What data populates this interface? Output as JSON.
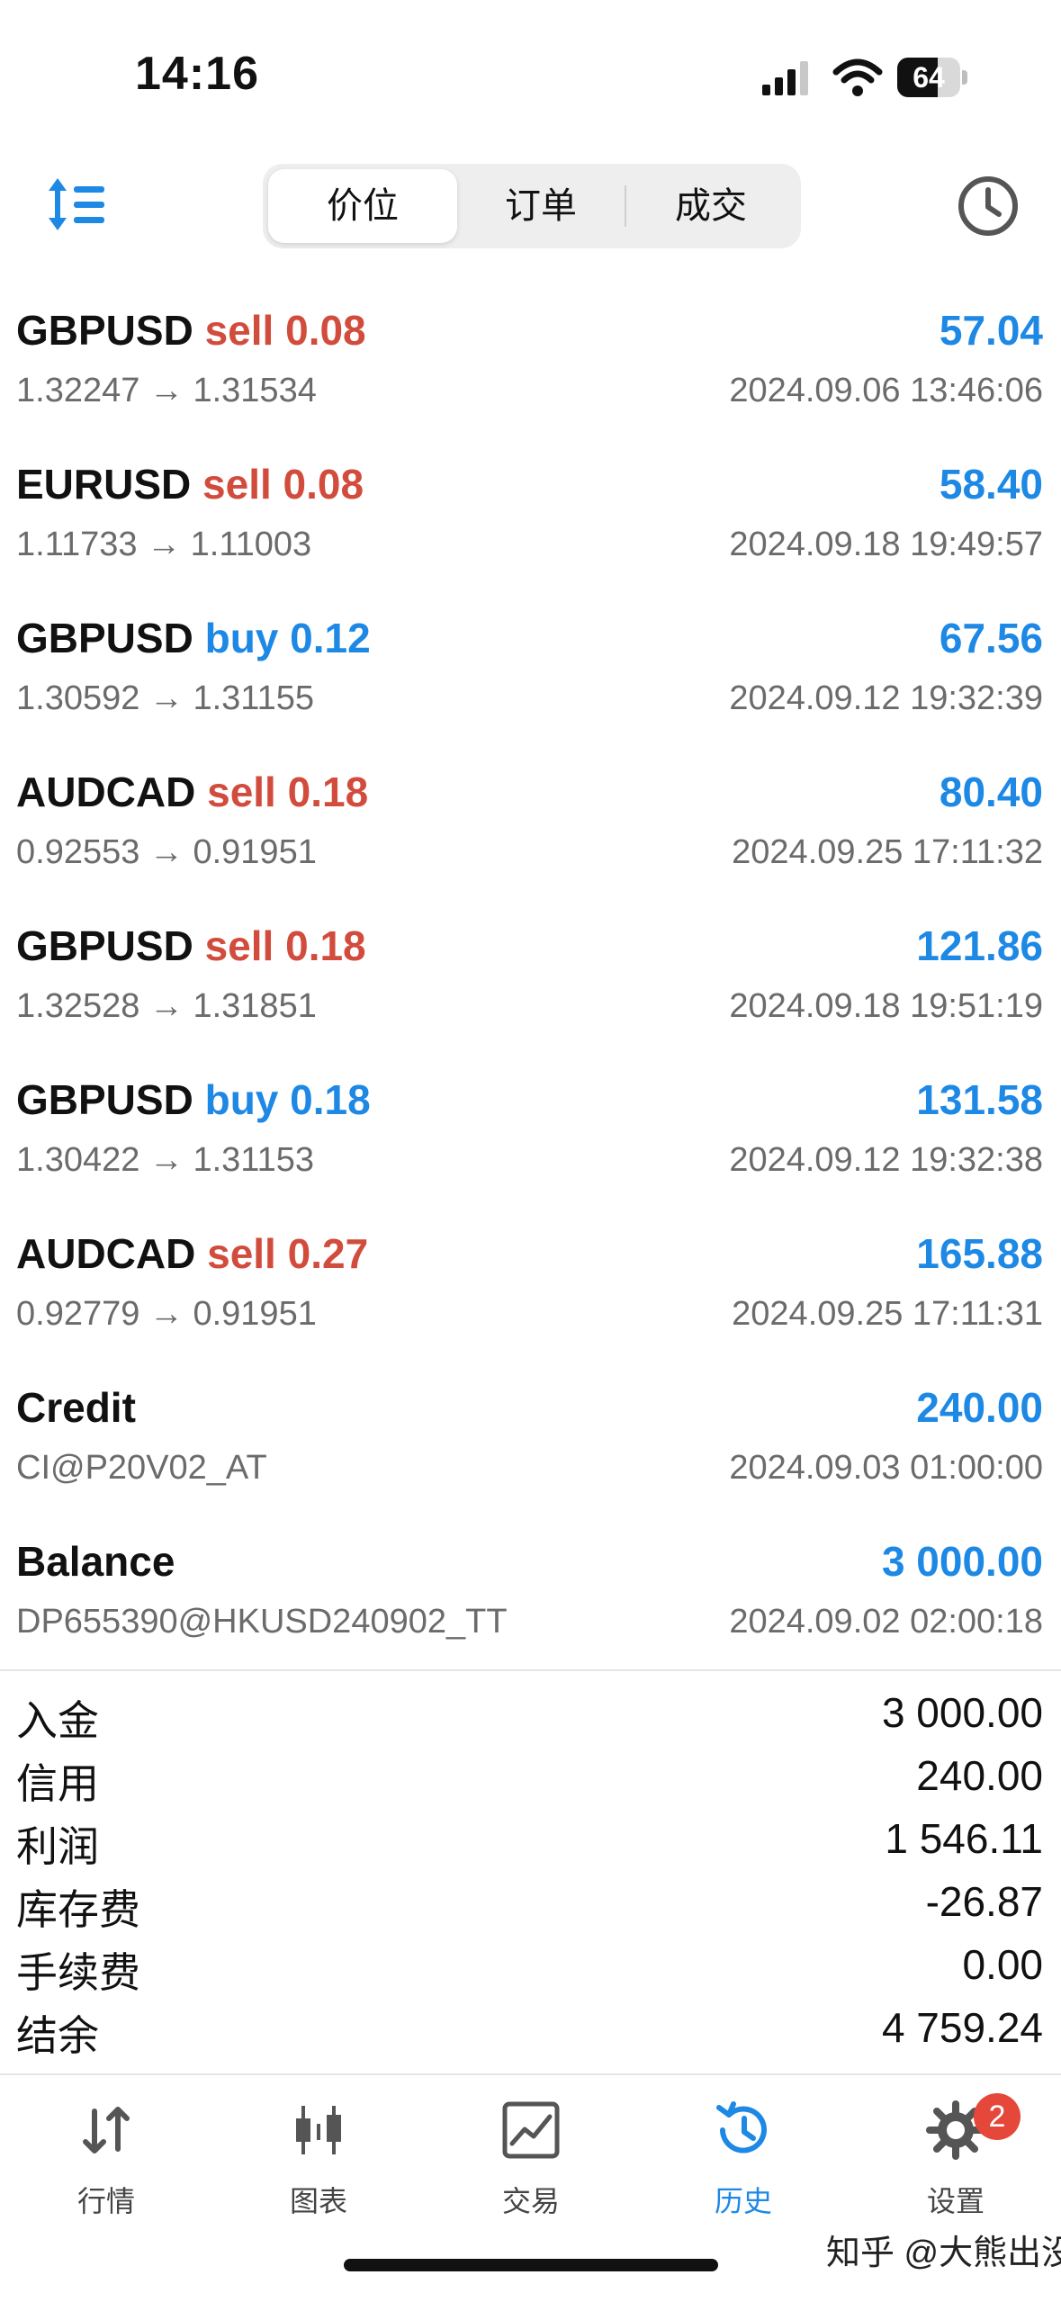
{
  "status_bar": {
    "time": "14:16",
    "battery": "64",
    "battery_level": 0.64
  },
  "segmented_tabs": [
    {
      "label": "价位",
      "active": true
    },
    {
      "label": "订单",
      "active": false
    },
    {
      "label": "成交",
      "active": false
    }
  ],
  "history": [
    {
      "symbol": "GBPUSD",
      "side": "sell",
      "volume": "0.08",
      "amount": "57.04",
      "detail": "1.32247 → 1.31534",
      "datetime": "2024.09.06 13:46:06"
    },
    {
      "symbol": "EURUSD",
      "side": "sell",
      "volume": "0.08",
      "amount": "58.40",
      "detail": "1.11733 → 1.11003",
      "datetime": "2024.09.18 19:49:57"
    },
    {
      "symbol": "GBPUSD",
      "side": "buy",
      "volume": "0.12",
      "amount": "67.56",
      "detail": "1.30592 → 1.31155",
      "datetime": "2024.09.12 19:32:39"
    },
    {
      "symbol": "AUDCAD",
      "side": "sell",
      "volume": "0.18",
      "amount": "80.40",
      "detail": "0.92553 → 0.91951",
      "datetime": "2024.09.25 17:11:32"
    },
    {
      "symbol": "GBPUSD",
      "side": "sell",
      "volume": "0.18",
      "amount": "121.86",
      "detail": "1.32528 → 1.31851",
      "datetime": "2024.09.18 19:51:19"
    },
    {
      "symbol": "GBPUSD",
      "side": "buy",
      "volume": "0.18",
      "amount": "131.58",
      "detail": "1.30422 → 1.31153",
      "datetime": "2024.09.12 19:32:38"
    },
    {
      "symbol": "AUDCAD",
      "side": "sell",
      "volume": "0.27",
      "amount": "165.88",
      "detail": "0.92779 → 0.91951",
      "datetime": "2024.09.25 17:11:31"
    },
    {
      "symbol": "Credit",
      "side": "",
      "volume": "",
      "amount": "240.00",
      "detail": "CI@P20V02_AT",
      "datetime": "2024.09.03 01:00:00"
    },
    {
      "symbol": "Balance",
      "side": "",
      "volume": "",
      "amount": "3 000.00",
      "detail": "DP655390@HKUSD240902_TT",
      "datetime": "2024.09.02 02:00:18"
    }
  ],
  "summary": [
    {
      "label": "入金",
      "value": "3 000.00"
    },
    {
      "label": "信用",
      "value": "240.00"
    },
    {
      "label": "利润",
      "value": "1 546.11"
    },
    {
      "label": "库存费",
      "value": "-26.87"
    },
    {
      "label": "手续费",
      "value": "0.00"
    },
    {
      "label": "结余",
      "value": "4 759.24"
    }
  ],
  "tabbar": [
    {
      "label": "行情",
      "icon": "quotes-arrows-icon",
      "active": false
    },
    {
      "label": "图表",
      "icon": "candlestick-chart-icon",
      "active": false
    },
    {
      "label": "交易",
      "icon": "trade-chart-icon",
      "active": false
    },
    {
      "label": "历史",
      "icon": "history-clock-icon",
      "active": true
    },
    {
      "label": "设置",
      "icon": "settings-gear-icon",
      "active": false,
      "badge": "2"
    }
  ],
  "watermark": "知乎 @大熊出没",
  "colors": {
    "accent": "#1e88e5",
    "sell": "#d24c3d",
    "buy": "#1e88e5",
    "badge": "#e5473a"
  }
}
